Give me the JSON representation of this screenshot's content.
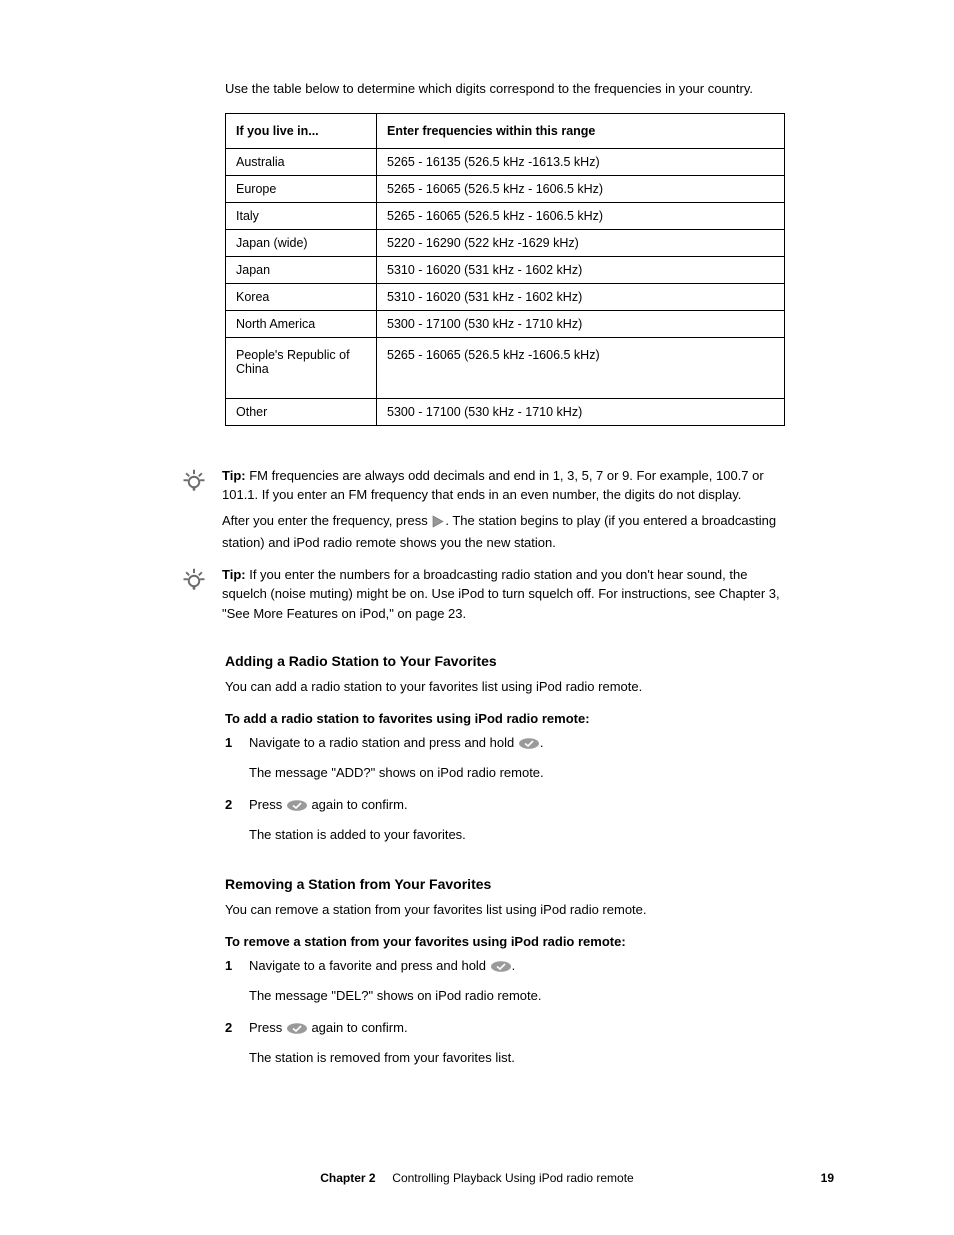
{
  "lead_text": "Use the table below to determine which digits correspond to the frequencies in your country.",
  "table": {
    "header_left": "If you live in...",
    "header_right": "Enter frequencies within this range",
    "rows": [
      {
        "region": "Australia",
        "range": "5265 - 16135 (526.5 kHz -1613.5 kHz)"
      },
      {
        "region": "Europe",
        "range": "5265 - 16065 (526.5 kHz - 1606.5 kHz)"
      },
      {
        "region": "Italy",
        "range": "5265 - 16065 (526.5 kHz - 1606.5 kHz)"
      },
      {
        "region": "Japan (wide)",
        "range": "5220 - 16290 (522 kHz -1629 kHz)"
      },
      {
        "region": "Japan",
        "range": "5310 - 16020 (531 kHz - 1602 kHz)"
      },
      {
        "region": "Korea",
        "range": "5310 - 16020 (531 kHz - 1602 kHz)"
      },
      {
        "region": "North America",
        "range": "5300 - 17100 (530 kHz - 1710 kHz)"
      },
      {
        "region": "People's Republic of China",
        "range": "5265 - 16065 (526.5 kHz -1606.5 kHz)"
      },
      {
        "region": "Other",
        "range": "5300 - 17100 (530 kHz - 1710 kHz)"
      }
    ]
  },
  "tip1_prefix": "Tip: ",
  "tip1_body": "FM frequencies are always odd decimals and end in 1, 3, 5, 7 or 9. For example, 100.7 or 101.1. If you enter an FM frequency that ends in an even number, the digits do not display.",
  "tip_after_text_prefix": "After you enter the frequency, press ",
  "tip_after_text_suffix": ". The station begins to play (if you entered a broadcasting station) and iPod radio remote shows you the new station.",
  "tip2_prefix": "Tip: ",
  "tip2_body": "If you enter the numbers for a broadcasting radio station and you don't hear sound, the squelch (noise muting) might be on. Use iPod to turn squelch off. For instructions, see Chapter 3, \"See More Features on iPod,\" on page 23.",
  "add_section_title": "Adding a Radio Station to Your Favorites",
  "add_body": "You can add a radio station to your favorites list using iPod radio remote.",
  "add_intro": "To add a radio station to favorites using iPod radio remote:",
  "add_steps": [
    {
      "n": "1",
      "body_prefix": "Navigate to a radio station and press and hold ",
      "body_suffix": "."
    },
    {
      "n": "",
      "plain": "The message \"ADD?\" shows on iPod radio remote."
    },
    {
      "n": "2",
      "body_prefix": "Press ",
      "body_suffix": " again to confirm."
    },
    {
      "n": "",
      "plain": "The station is added to your favorites."
    }
  ],
  "remove_section_title": "Removing a Station from Your Favorites",
  "remove_body": "You can remove a station from your favorites list using iPod radio remote.",
  "remove_intro": "To remove a station from your favorites using iPod radio remote:",
  "remove_steps": [
    {
      "n": "1",
      "body_prefix": "Navigate to a favorite and press and hold ",
      "body_suffix": "."
    },
    {
      "n": "",
      "plain": "The message \"DEL?\" shows on iPod radio remote."
    },
    {
      "n": "2",
      "body_prefix": "Press ",
      "body_suffix": " again to confirm."
    },
    {
      "n": "",
      "plain": "The station is removed from your favorites list."
    }
  ],
  "footer_left": "Chapter 2",
  "footer_right": "Controlling Playback Using iPod radio remote",
  "page_number": "19"
}
